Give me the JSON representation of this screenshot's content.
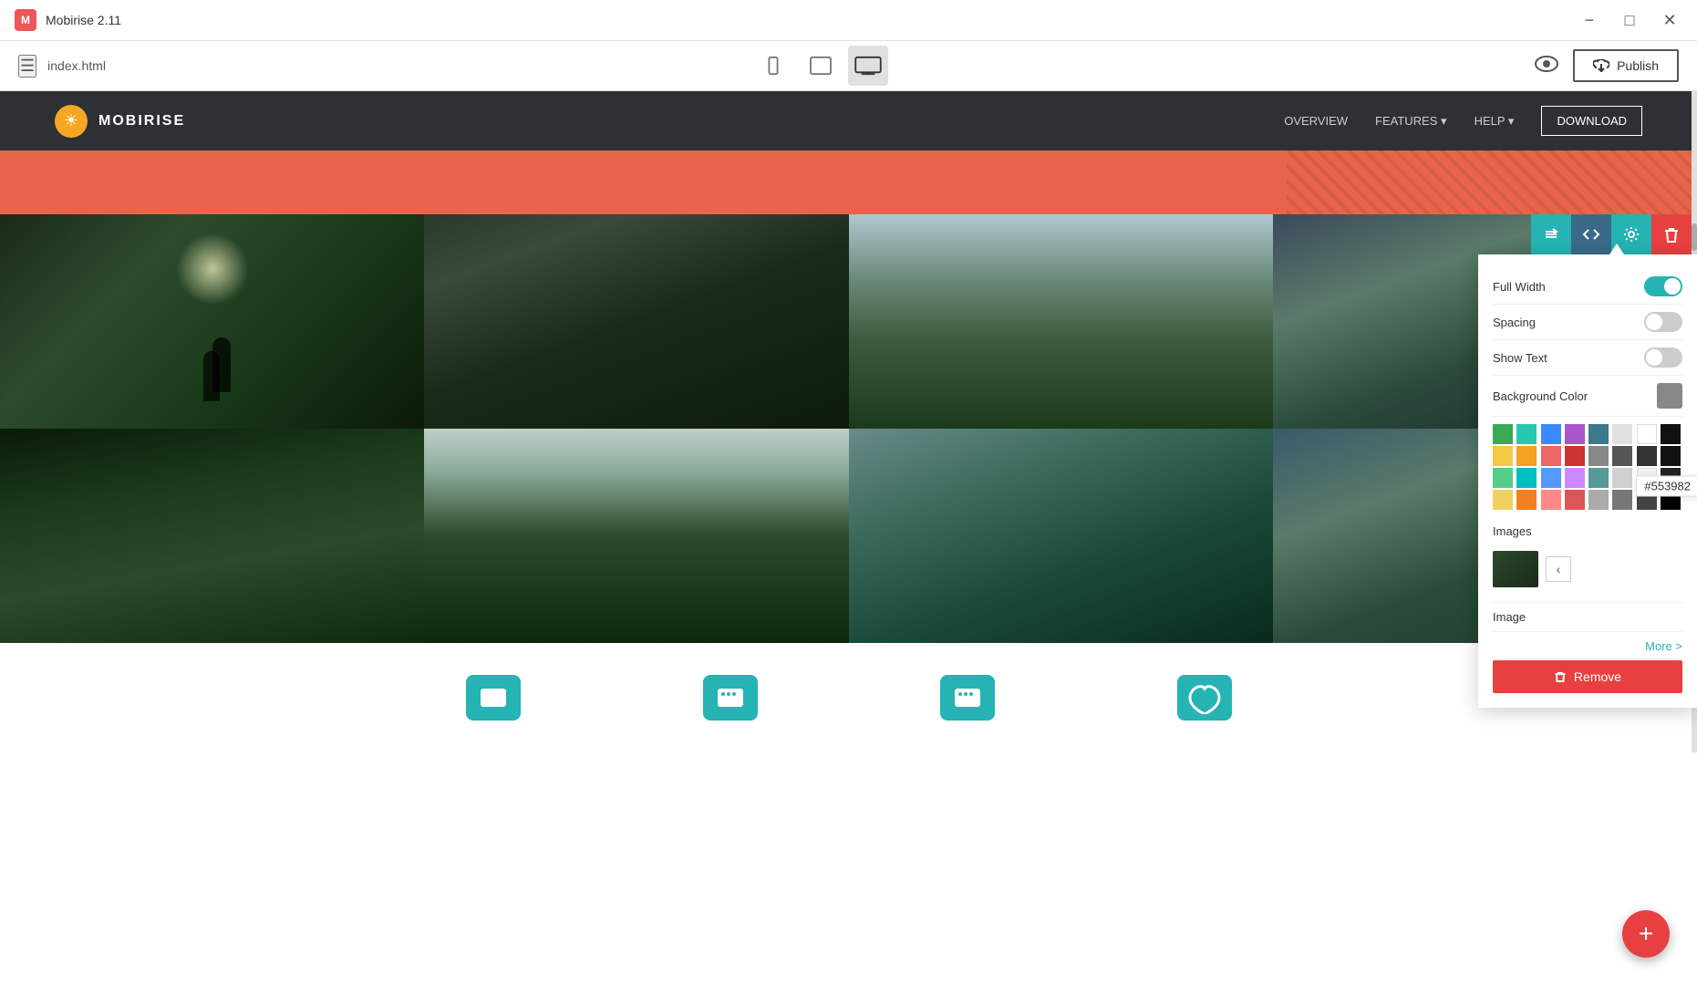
{
  "titleBar": {
    "appName": "Mobirise 2.11",
    "minBtn": "−",
    "maxBtn": "□",
    "closeBtn": "✕"
  },
  "toolbar": {
    "hamburger": "☰",
    "fileName": "index.html",
    "devices": [
      {
        "id": "mobile",
        "icon": "📱",
        "label": "mobile"
      },
      {
        "id": "tablet",
        "icon": "📱",
        "label": "tablet"
      },
      {
        "id": "desktop",
        "icon": "🖥",
        "label": "desktop",
        "active": true
      }
    ],
    "previewIcon": "👁",
    "publishIcon": "☁",
    "publishLabel": "Publish"
  },
  "siteNav": {
    "logoText": "MOBIRISE",
    "navItems": [
      "OVERVIEW",
      "FEATURES ▾",
      "HELP ▾"
    ],
    "downloadBtn": "DOWNLOAD"
  },
  "colorPanel": {
    "fullWidthLabel": "Full Width",
    "spacingLabel": "Spacing",
    "showTextLabel": "Show Text",
    "backgroundColorLabel": "Background Color",
    "imagesLabel": "Images",
    "imageLabel": "Image",
    "moreLabel": "More >",
    "removeLabel": "Remove",
    "hexValue": "#553982",
    "colors": [
      "#3aaa55",
      "#26c8b0",
      "#3a8aff",
      "#aa55cc",
      "#3a7a8a",
      "#f5f5f5",
      "#ffffff",
      "#000000",
      "#f5c842",
      "#f5a020",
      "#ee5555",
      "#cc3333",
      "#888888",
      "#555555",
      "#333333",
      "#111111",
      "#55cc88",
      "#00bfbf",
      "#5599ff",
      "#cc88ff",
      "#559999",
      "#e0e0e0",
      "#d0d0d0",
      "#222222",
      "#f0d060",
      "#f08020",
      "#ff8888",
      "#dd5555",
      "#aaaaaa",
      "#777777",
      "#444444",
      "#000000"
    ]
  },
  "addBtn": "+"
}
